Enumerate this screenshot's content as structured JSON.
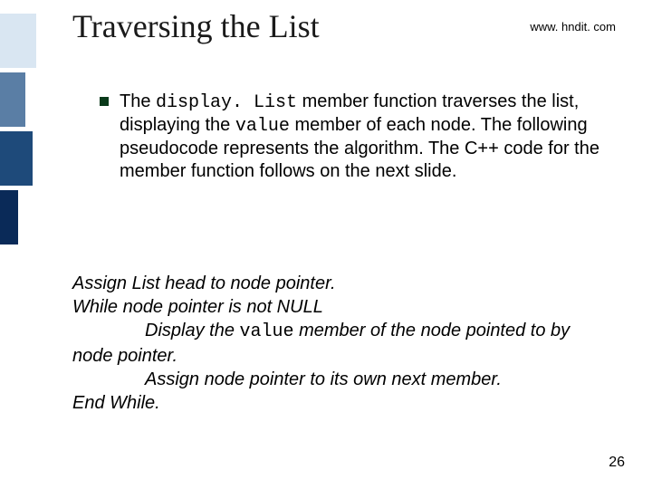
{
  "header": {
    "title": "Traversing the List",
    "url": "www. hndit. com"
  },
  "bullet": {
    "p1": "The ",
    "code1": "display. List",
    "p2": " member function traverses the list, displaying the ",
    "code2": "value",
    "p3": " member of each node. The following pseudocode represents the algorithm. The C++ code for the member function follows on the next slide."
  },
  "pseudo": {
    "line1": "Assign List head to node pointer.",
    "line2": "While node pointer is not NULL",
    "line3a": "Display the ",
    "line3code": "value",
    "line3b": " member of the node pointed to by",
    "line4": "node pointer.",
    "line5": "Assign node pointer to its own next member.",
    "line6": "End While."
  },
  "page": "26"
}
